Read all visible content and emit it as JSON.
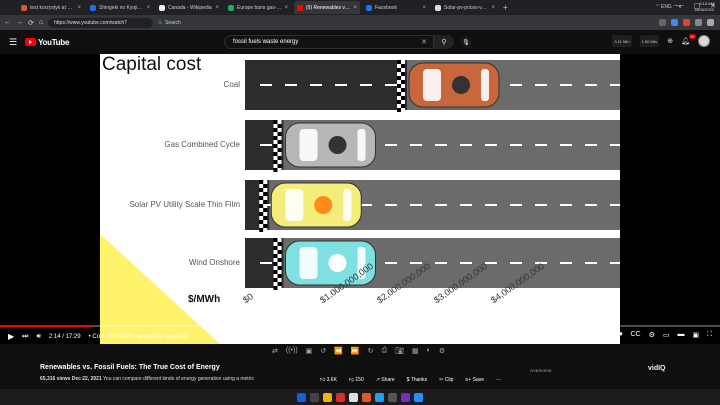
{
  "tabs": [
    {
      "label": "test korzystyk at DuckDuckGo",
      "color": "#de5833",
      "active": false
    },
    {
      "label": "Shingeki no Kyojin Season 2 | E",
      "color": "#1f6feb",
      "active": false
    },
    {
      "label": "Canada - Wikipedia",
      "color": "#eeeeee",
      "active": false
    },
    {
      "label": "Europe bans gas-powered vehi",
      "color": "#22aa66",
      "active": false
    },
    {
      "label": "(9) Renewables vs. Fossil Fuels",
      "color": "#ff0000",
      "active": true
    },
    {
      "label": "Facebook",
      "color": "#1877f2",
      "active": false
    },
    {
      "label": "Solar-pv-prices-vs-cumulative",
      "color": "#dddddd",
      "active": false
    }
  ],
  "browser": {
    "url": "https://www.youtube.com/watch?",
    "bookmark": "Search"
  },
  "header": {
    "logo_text": "YouTube",
    "search_value": "fossil fuels waste energy",
    "box1": "3.11 MIn",
    "box2": "1.50 MIn",
    "notif_count": "9+"
  },
  "slide": {
    "title": "Capital cost",
    "rows": [
      {
        "label": "Coal",
        "value": 1.6
      },
      {
        "label": "Gas Combined Cycle",
        "value": 0.3
      },
      {
        "label": "Solar PV Utility Scale Thin Film",
        "value": 0.15
      },
      {
        "label": "Wind Onshore",
        "value": 0.3
      }
    ],
    "y_unit": "$/MWh",
    "x_ticks": [
      "$0",
      "$1,000,000,000",
      "$2,000,000,000",
      "$3,000,000,000",
      "$4,000,000,000"
    ]
  },
  "player": {
    "time": "2:14 / 17:29",
    "chapter": "• Cost of 500MW nameplate capacity",
    "progress": 0.128
  },
  "video": {
    "title": "Renewables vs. Fossil Fuels: The True Cost of Energy",
    "views": "65,316 views",
    "date": "Dec 22, 2021",
    "desc": "You can compare different kinds of energy generation using a metric",
    "likes": "3.6K",
    "comments": "150",
    "share": "Share",
    "thanks": "Thanks",
    "clip": "Clip",
    "save": "Save",
    "overview": "OVERVIEW",
    "vidiq": "vidIQ"
  },
  "taskbar": {
    "lang": "ENG",
    "time": "6:10 AM",
    "date": "18/06/2022",
    "icon_colors": [
      "#0a64d8",
      "#444444",
      "#f2b600",
      "#d32f2f",
      "#e0e0e0",
      "#e0582e",
      "#1da1f2",
      "#555555",
      "#7b2cbf",
      "#1e90ff"
    ]
  }
}
